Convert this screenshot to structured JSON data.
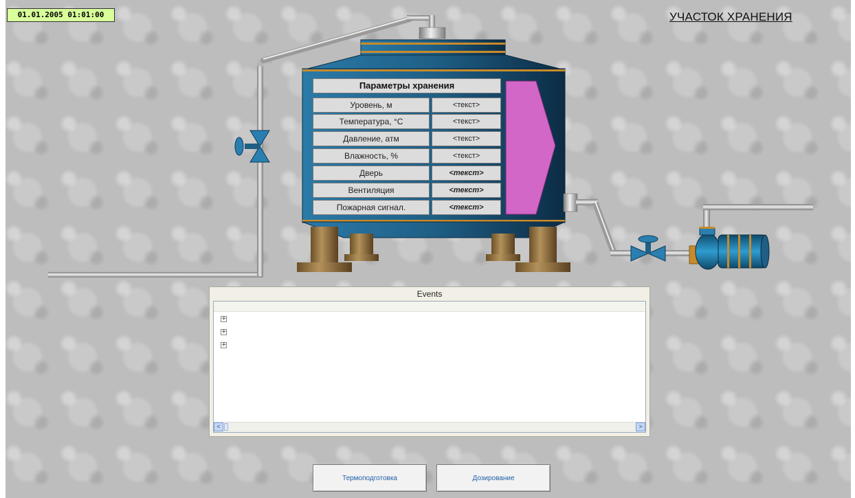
{
  "header": {
    "datetime": "01.01.2005 01:01:00",
    "area_title": "УЧАСТОК ХРАНЕНИЯ"
  },
  "params": {
    "title": "Параметры хранения",
    "rows": [
      {
        "label": "Уровень, м",
        "value": "<текст>"
      },
      {
        "label": "Температура, °С",
        "value": "<текст>"
      },
      {
        "label": "Давление, атм",
        "value": "<текст>"
      },
      {
        "label": "Влажность, %",
        "value": "<текст>"
      },
      {
        "label": "Дверь",
        "value": "<текст>"
      },
      {
        "label": "Вентиляция",
        "value": "<текст>"
      },
      {
        "label": "Пожарная сигнал.",
        "value": "<текст>"
      }
    ]
  },
  "events": {
    "title": "Events",
    "tree_nodes": [
      "+",
      "+",
      "+"
    ],
    "scroll_left": "<",
    "scroll_right": ">"
  },
  "nav": {
    "thermo_label": "Термоподготовка",
    "dosing_label": "Дозирование"
  },
  "colors": {
    "tank_body": "#1f5f86",
    "tank_band": "#c98b2a",
    "pipe": "#a9a9a9",
    "legs": "#8a6a3a",
    "indicator": "#d267c8",
    "valve": "#2a7fb0",
    "datetime_bg": "#d8ff9a"
  }
}
